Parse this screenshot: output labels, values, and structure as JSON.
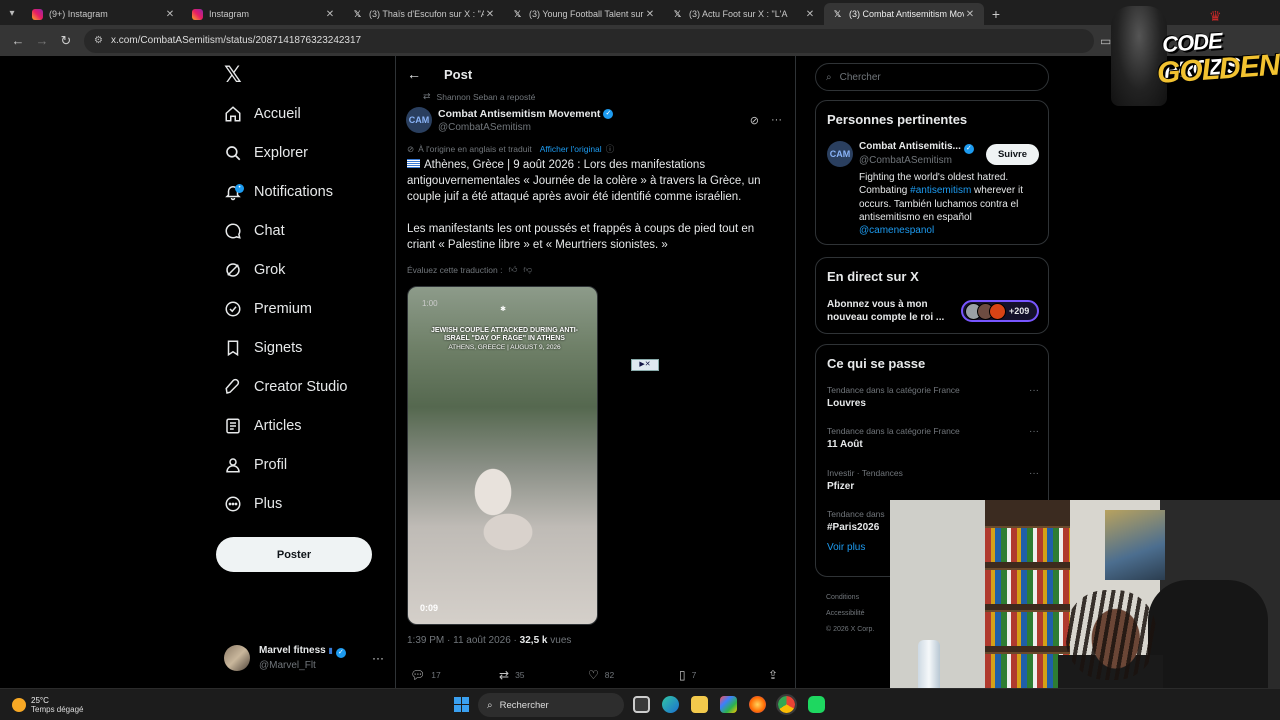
{
  "browser": {
    "tabs": [
      {
        "title": "(9+) Instagram",
        "icon": "instagram"
      },
      {
        "title": "Instagram",
        "icon": "instagram"
      },
      {
        "title": "(3) Thaïs d'Escufon sur X : \"Alors",
        "icon": "x"
      },
      {
        "title": "(3) Young Football Talent sur X",
        "icon": "x"
      },
      {
        "title": "(3) Actu Foot sur X : \"L'A",
        "icon": "x"
      },
      {
        "title": "(3) Combat Antisemitism Move",
        "icon": "x",
        "active": true
      }
    ],
    "url": "x.com/CombatASemitism/status/2087141876323242317"
  },
  "nav": {
    "items": [
      {
        "label": "Accueil",
        "icon": "home-icon"
      },
      {
        "label": "Explorer",
        "icon": "search-icon"
      },
      {
        "label": "Notifications",
        "icon": "bell-icon"
      },
      {
        "label": "Chat",
        "icon": "chat-icon"
      },
      {
        "label": "Grok",
        "icon": "grok-icon"
      },
      {
        "label": "Premium",
        "icon": "premium-icon"
      },
      {
        "label": "Signets",
        "icon": "bookmark-icon"
      },
      {
        "label": "Creator Studio",
        "icon": "rocket-icon"
      },
      {
        "label": "Articles",
        "icon": "article-icon"
      },
      {
        "label": "Profil",
        "icon": "person-icon"
      },
      {
        "label": "Plus",
        "icon": "more-circle-icon"
      }
    ],
    "post_button": "Poster",
    "account": {
      "name": "Marvel fitness",
      "handle": "@Marvel_Flt"
    }
  },
  "post": {
    "header_title": "Post",
    "repost_note": "Shannon Seban a reposté",
    "author": {
      "name": "Combat Antisemitism Movement",
      "handle": "@CombatASemitism"
    },
    "translation_note": "À l'origine en anglais et traduit",
    "show_original": "Afficher l'original",
    "paragraph1": "Athènes, Grèce | 9 août 2026 : Lors des manifestations antigouvernementales « Journée de la colère » à travers la Grèce, un couple juif a été attaqué après avoir été identifié comme israélien.",
    "paragraph2": "Les manifestants les ont poussés et frappés à coups de pied tout en criant « Palestine libre » et « Meurtriers sionistes. »",
    "rate_translation": "Évaluez cette traduction :",
    "video": {
      "timestamp": "1:00",
      "caption_line1": "JEWISH COUPLE ATTACKED DURING ANTI-ISRAEL \"DAY OF RAGE\" IN ATHENS",
      "caption_line2": "ATHENS, GREECE | AUGUST 9, 2026",
      "duration": "0:09"
    },
    "time": "1:39 PM · 11 août 2026 · ",
    "views_count": "32,5 k",
    "views_label": " vues",
    "replies": "17",
    "reposts": "35",
    "likes": "82",
    "bookmarks": "7"
  },
  "sidebar": {
    "search_placeholder": "Chercher",
    "relevant": {
      "title": "Personnes pertinentes",
      "name": "Combat Antisemitis...",
      "handle": "@CombatASemitism",
      "follow": "Suivre",
      "bio_1": "Fighting the world's oldest hatred. Combating ",
      "bio_tag": "#antisemitism",
      "bio_2": " wherever it occurs. También luchamos contra el antisemitismo en español",
      "bio_mention": "@camenespanol"
    },
    "live": {
      "title": "En direct sur X",
      "text": "Abonnez vous à mon nouveau compte le roi ...",
      "count": "+209"
    },
    "happening": {
      "title": "Ce qui se passe",
      "trends": [
        {
          "context": "Tendance dans la catégorie France",
          "topic": "Louvres"
        },
        {
          "context": "Tendance dans la catégorie France",
          "topic": "11 Août"
        },
        {
          "context": "Investir · Tendances",
          "topic": "Pfizer"
        },
        {
          "context": "Tendance dans",
          "topic": "#Paris2026"
        }
      ],
      "see_more": "Voir plus"
    },
    "footer": [
      "Conditions",
      "Accessibilité",
      "© 2026 X Corp."
    ]
  },
  "overlay": {
    "brand_line1": "CODE PROZIS",
    "brand_line2": "GOLDENG"
  },
  "taskbar": {
    "temperature": "25°C",
    "condition": "Temps dégagé",
    "search": "Rechercher"
  },
  "colors": {
    "accent": "#1d9bf0",
    "background": "#000000",
    "muted_text": "#71767b"
  }
}
